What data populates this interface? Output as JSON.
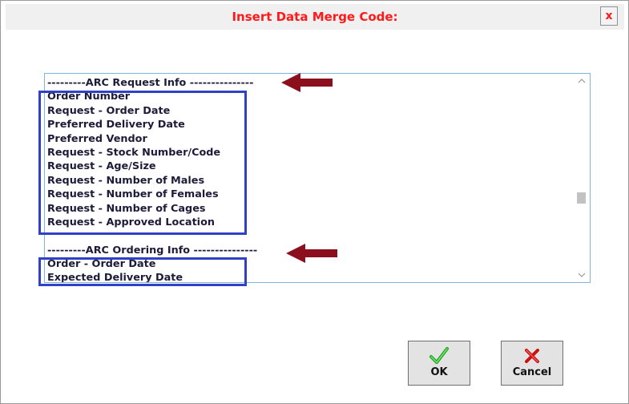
{
  "dialog": {
    "title": "Insert Data Merge Code:",
    "close_label": "x"
  },
  "list": {
    "items": [
      "---------ARC Request Info ---------------",
      "Order Number",
      "Request - Order Date",
      "Preferred Delivery Date",
      "Preferred Vendor",
      "Request - Stock Number/Code",
      "Request - Age/Size",
      "Request - Number of Males",
      "Request - Number of Females",
      "Request - Number of Cages",
      "Request - Approved Location",
      "",
      "---------ARC Ordering Info ---------------",
      "Order - Order Date",
      "Expected Delivery Date"
    ],
    "scroll_up_icon": "chevron-up-icon",
    "scroll_down_icon": "chevron-down-icon"
  },
  "buttons": {
    "ok_label": "OK",
    "ok_icon": "green-checkmark-icon",
    "cancel_label": "Cancel",
    "cancel_icon": "red-x-icon"
  },
  "colors": {
    "title": "#ff1a1a",
    "highlight_box": "#3240c8",
    "arrow": "#8b0f1c",
    "list_border": "#7fb5df"
  }
}
